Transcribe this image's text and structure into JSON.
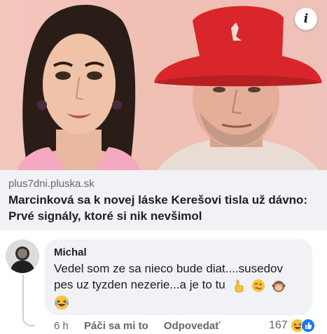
{
  "preview": {
    "info_icon_glyph": "i",
    "domain": "plus7dni.pluska.sk",
    "title": "Marcinková sa k novej láske Kerešovi tisla už dávno: Prvé signály, ktoré si nik nevšimol"
  },
  "comment": {
    "author": "Michal",
    "text_line1": "Vedel som ze sa nieco bude diat....susedov",
    "text_line2": "pes uz tyzden nezerie...a je to tu",
    "emojis": [
      "pointing-up-icon",
      "woozy-face-icon",
      "see-no-evil-monkey-icon",
      "laughing-tears-icon"
    ],
    "time": "6 h",
    "like_label": "Páči sa mi to",
    "reply_label": "Odpovedať",
    "reaction_count": "167",
    "reaction_icons": [
      "haha-reaction-icon",
      "like-reaction-icon"
    ]
  },
  "colors": {
    "bubble": "#f0f2f5",
    "secondary_text": "#65676b",
    "primary_text": "#1c1e21",
    "hat_red": "#d9262b"
  }
}
